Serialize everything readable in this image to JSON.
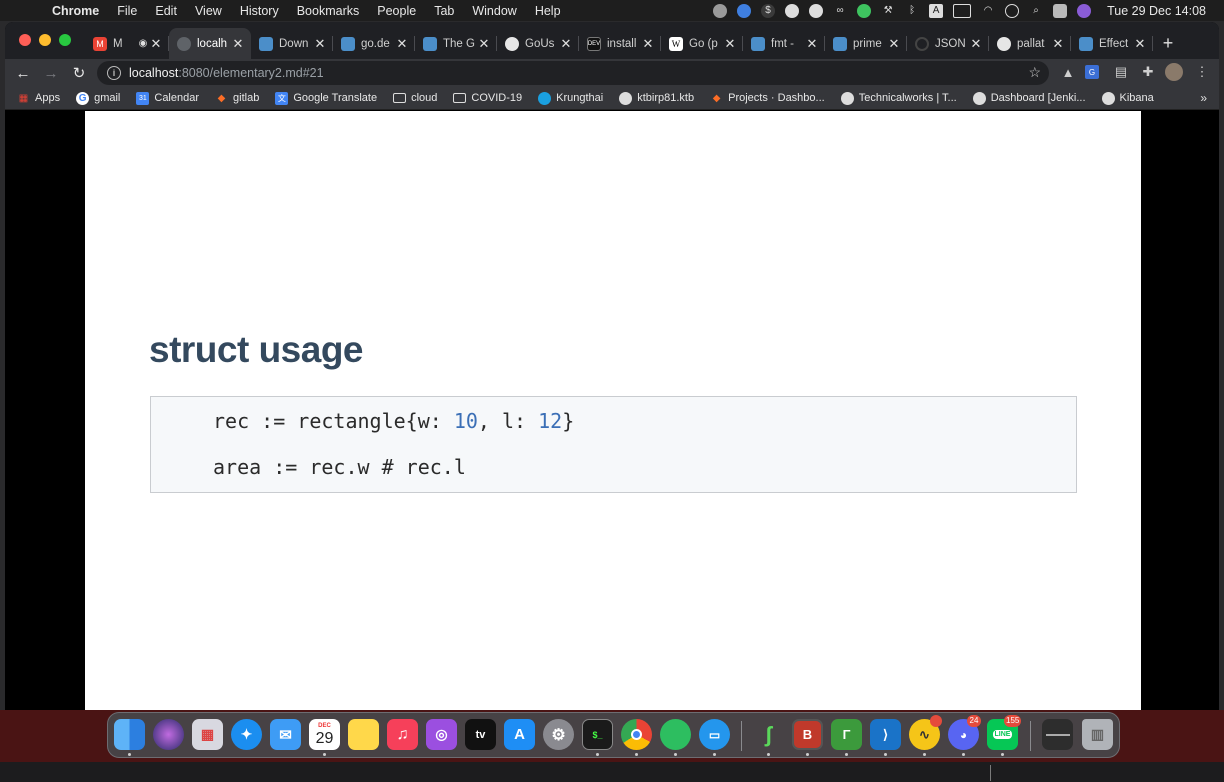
{
  "menubar": {
    "app": "Chrome",
    "items": [
      "File",
      "Edit",
      "View",
      "History",
      "Bookmarks",
      "People",
      "Tab",
      "Window",
      "Help"
    ],
    "clock": "Tue 29 Dec  14:08",
    "input_source": "A"
  },
  "tabs": [
    {
      "title": "M",
      "active": false,
      "icon": "gmail-icon"
    },
    {
      "title": "localh",
      "active": true,
      "icon": "globe-icon"
    },
    {
      "title": "Down",
      "active": false,
      "icon": "doc-icon"
    },
    {
      "title": "go.de",
      "active": false,
      "icon": "doc-icon"
    },
    {
      "title": "The G",
      "active": false,
      "icon": "doc-icon"
    },
    {
      "title": "GoUs",
      "active": false,
      "icon": "github-icon"
    },
    {
      "title": "install",
      "active": false,
      "icon": "dev-icon"
    },
    {
      "title": "Go (p",
      "active": false,
      "icon": "wikipedia-icon"
    },
    {
      "title": "fmt -",
      "active": false,
      "icon": "doc-icon"
    },
    {
      "title": "prime",
      "active": false,
      "icon": "doc-icon"
    },
    {
      "title": "JSON",
      "active": false,
      "icon": "loading-icon"
    },
    {
      "title": "pallat",
      "active": false,
      "icon": "github-icon"
    },
    {
      "title": "Effect",
      "active": false,
      "icon": "doc-icon"
    }
  ],
  "address": {
    "host": "localhost",
    "path": ":8080/elementary2.md#21"
  },
  "bookmarks": [
    {
      "label": "Apps",
      "icon": "apps-grid-icon"
    },
    {
      "label": "gmail",
      "icon": "google-icon"
    },
    {
      "label": "Calendar",
      "icon": "calendar-icon"
    },
    {
      "label": "gitlab",
      "icon": "gitlab-icon"
    },
    {
      "label": "Google Translate",
      "icon": "translate-icon"
    },
    {
      "label": "cloud",
      "icon": "folder-icon"
    },
    {
      "label": "COVID-19",
      "icon": "folder-icon"
    },
    {
      "label": "Krungthai",
      "icon": "bank-icon"
    },
    {
      "label": "ktbirp81.ktb",
      "icon": "globe-icon"
    },
    {
      "label": "Projects · Dashbo...",
      "icon": "gitlab-icon"
    },
    {
      "label": "Technicalworks | T...",
      "icon": "globe-icon"
    },
    {
      "label": "Dashboard [Jenki...",
      "icon": "globe-icon"
    },
    {
      "label": "Kibana",
      "icon": "globe-icon"
    }
  ],
  "slide": {
    "title": "struct usage",
    "code": {
      "line1_pre": "rec := rectangle{w: ",
      "line1_n1": "10",
      "line1_mid": ", l: ",
      "line1_n2": "12",
      "line1_post": "}",
      "line2": "area := rec.w # rec.l"
    }
  },
  "dock": {
    "calendar_month": "DEC",
    "calendar_day": "29",
    "tv_label": "tv",
    "discord_badge": "24",
    "line_badge": "155",
    "line_label": "LINE"
  },
  "colors": {
    "heading": "#34495e",
    "code_number": "#3b6fb6",
    "code_bg": "#f6f8fa"
  }
}
